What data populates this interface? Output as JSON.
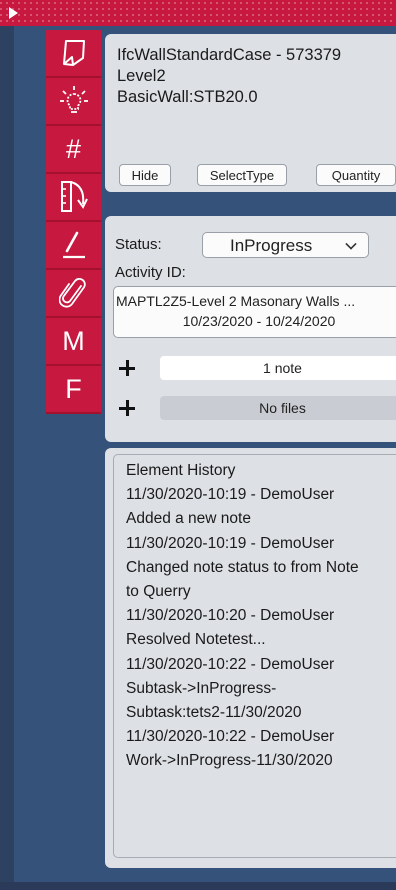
{
  "colors": {
    "accent": "#c7183f",
    "background": "#2d4160",
    "panel": "#dde0e5"
  },
  "toolbar": {
    "items": [
      {
        "name": "sticky-note-icon",
        "glyph": ""
      },
      {
        "name": "lightbulb-icon",
        "glyph": ""
      },
      {
        "name": "hash-icon",
        "glyph": "#"
      },
      {
        "name": "measure-icon",
        "glyph": ""
      },
      {
        "name": "pen-icon",
        "glyph": ""
      },
      {
        "name": "paperclip-icon",
        "glyph": ""
      },
      {
        "name": "m-icon",
        "glyph": "M"
      },
      {
        "name": "f-icon",
        "glyph": "F"
      }
    ]
  },
  "element": {
    "title": "IfcWallStandardCase - 573379",
    "level": "Level2",
    "type": "BasicWall:STB20.0",
    "buttons": {
      "hide": "Hide",
      "select_type": "SelectType",
      "quantity": "Quantity"
    }
  },
  "status": {
    "label": "Status:",
    "value": "InProgress",
    "activity_label": "Activity ID:",
    "activity_name": "MAPTL2Z5-Level 2 Masonary Walls ...",
    "activity_dates": "10/23/2020 - 10/24/2020",
    "notes_label": "1 note",
    "files_label": "No files"
  },
  "history": {
    "lines": [
      "Element History",
      "11/30/2020-10:19 - DemoUser",
      "Added a new note",
      "11/30/2020-10:19 - DemoUser",
      "Changed note status to from Note",
      "to Querry",
      "11/30/2020-10:20 - DemoUser",
      "Resolved Notetest...",
      "11/30/2020-10:22 - DemoUser",
      "Subtask->InProgress-",
      "Subtask:tets2-11/30/2020",
      "11/30/2020-10:22 - DemoUser",
      "Work->InProgress-11/30/2020"
    ]
  }
}
